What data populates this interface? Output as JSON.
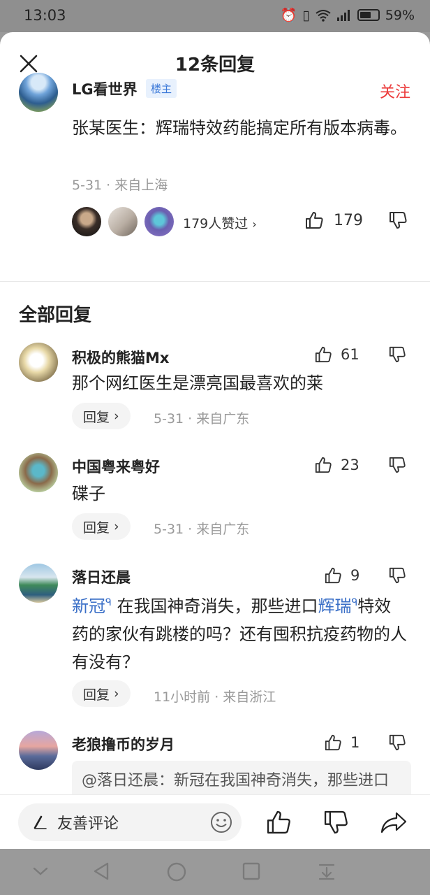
{
  "status_bar": {
    "time": "13:03",
    "battery": "59%"
  },
  "header": {
    "title": "12条回复"
  },
  "original_post": {
    "author": "LG看世界",
    "badge": "楼主",
    "follow_label": "关注",
    "text": "张某医生：辉瑞特效药能搞定所有版本病毒。",
    "meta": "5-31 · 来自上海",
    "likes_summary": "179人赞过",
    "like_count": "179"
  },
  "section": {
    "title": "全部回复"
  },
  "comments": [
    {
      "author": "积极的熊猫Mx",
      "likes": "61",
      "text": "那个网红医生是漂亮国最喜欢的莱",
      "reply_label": "回复",
      "meta": "5-31 · 来自广东"
    },
    {
      "author": "中国粤来粤好",
      "likes": "23",
      "text": "碟子",
      "reply_label": "回复",
      "meta": "5-31 · 来自广东"
    },
    {
      "author": "落日还晨",
      "likes": "9",
      "topic1": "新冠",
      "text_part1": " 在我国神奇消失，那些进口",
      "topic2": "辉瑞",
      "text_part2": "特效药的家伙有跳楼的吗？还有囤积抗疫药物的人有没有？",
      "reply_label": "回复",
      "meta": "11小时前 · 来自浙江"
    },
    {
      "author": "老狼撸币的岁月",
      "likes": "1",
      "quote": "@落日还晨：新冠在我国神奇消失，那些进口辉瑞特效药的家伙有跳楼的吗？"
    }
  ],
  "bottom_bar": {
    "input_placeholder": "友善评论"
  },
  "colors": {
    "accent_red": "#ec3b3b",
    "link_blue": "#3a6fc7",
    "badge_bg": "#e8f1fd"
  }
}
